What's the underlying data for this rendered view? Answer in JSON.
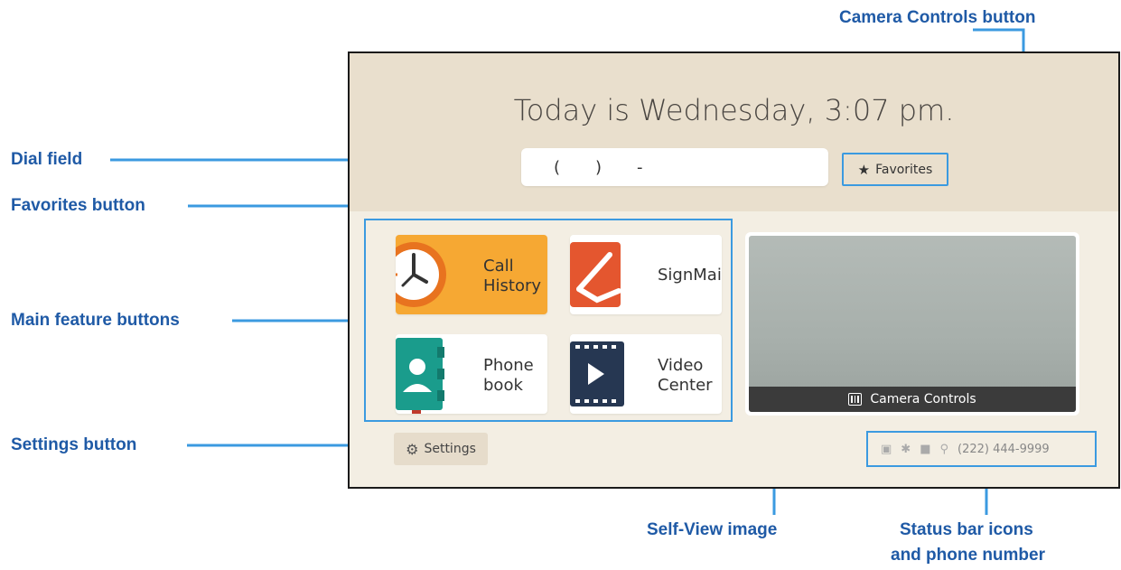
{
  "callouts": {
    "dial_field": "Dial field",
    "favorites_button": "Favorites button",
    "main_feature_buttons": "Main feature buttons",
    "settings_button": "Settings button",
    "camera_controls_button": "Camera Controls button",
    "self_view_image": "Self-View image",
    "status_bar_line1": "Status bar icons",
    "status_bar_line2": "and phone number"
  },
  "header": {
    "greeting": "Today is Wednesday, 3:07 pm.",
    "dial": {
      "open_paren": "(",
      "close_paren": ")",
      "dash": "-"
    },
    "favorites_label": "Favorites",
    "favorites_icon": "star-icon"
  },
  "features": [
    {
      "label": "Call\nHistory",
      "icon": "clock-icon"
    },
    {
      "label": "SignMail",
      "icon": "signmail-icon"
    },
    {
      "label": "Phone\nbook",
      "icon": "phonebook-icon"
    },
    {
      "label": "Video\nCenter",
      "icon": "film-icon"
    }
  ],
  "settings": {
    "label": "Settings",
    "icon": "gear-icon"
  },
  "self_view": {
    "camera_controls_label": "Camera Controls",
    "camera_controls_icon": "sliders-icon"
  },
  "status_bar": {
    "icons": [
      "message-icon",
      "bluetooth-icon",
      "video-camera-icon",
      "microphone-icon"
    ],
    "phone_number": "(222) 444-9999"
  },
  "colors": {
    "callout": "#1f5aa6",
    "highlight": "#3b9ae0",
    "arrow": "#3b9ae0",
    "call_history_tile": "#f6a833"
  }
}
